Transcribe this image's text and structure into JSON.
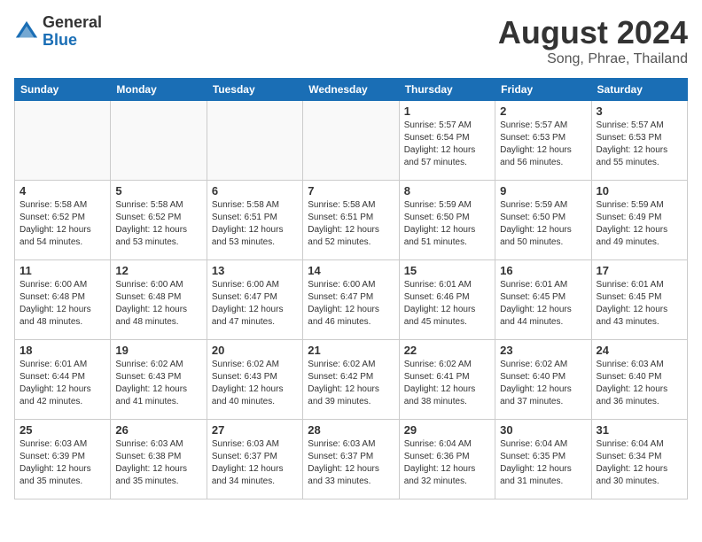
{
  "logo": {
    "general": "General",
    "blue": "Blue"
  },
  "title": "August 2024",
  "subtitle": "Song, Phrae, Thailand",
  "days_of_week": [
    "Sunday",
    "Monday",
    "Tuesday",
    "Wednesday",
    "Thursday",
    "Friday",
    "Saturday"
  ],
  "weeks": [
    [
      {
        "day": "",
        "info": ""
      },
      {
        "day": "",
        "info": ""
      },
      {
        "day": "",
        "info": ""
      },
      {
        "day": "",
        "info": ""
      },
      {
        "day": "1",
        "info": "Sunrise: 5:57 AM\nSunset: 6:54 PM\nDaylight: 12 hours and 57 minutes."
      },
      {
        "day": "2",
        "info": "Sunrise: 5:57 AM\nSunset: 6:53 PM\nDaylight: 12 hours and 56 minutes."
      },
      {
        "day": "3",
        "info": "Sunrise: 5:57 AM\nSunset: 6:53 PM\nDaylight: 12 hours and 55 minutes."
      }
    ],
    [
      {
        "day": "4",
        "info": "Sunrise: 5:58 AM\nSunset: 6:52 PM\nDaylight: 12 hours and 54 minutes."
      },
      {
        "day": "5",
        "info": "Sunrise: 5:58 AM\nSunset: 6:52 PM\nDaylight: 12 hours and 53 minutes."
      },
      {
        "day": "6",
        "info": "Sunrise: 5:58 AM\nSunset: 6:51 PM\nDaylight: 12 hours and 53 minutes."
      },
      {
        "day": "7",
        "info": "Sunrise: 5:58 AM\nSunset: 6:51 PM\nDaylight: 12 hours and 52 minutes."
      },
      {
        "day": "8",
        "info": "Sunrise: 5:59 AM\nSunset: 6:50 PM\nDaylight: 12 hours and 51 minutes."
      },
      {
        "day": "9",
        "info": "Sunrise: 5:59 AM\nSunset: 6:50 PM\nDaylight: 12 hours and 50 minutes."
      },
      {
        "day": "10",
        "info": "Sunrise: 5:59 AM\nSunset: 6:49 PM\nDaylight: 12 hours and 49 minutes."
      }
    ],
    [
      {
        "day": "11",
        "info": "Sunrise: 6:00 AM\nSunset: 6:48 PM\nDaylight: 12 hours and 48 minutes."
      },
      {
        "day": "12",
        "info": "Sunrise: 6:00 AM\nSunset: 6:48 PM\nDaylight: 12 hours and 48 minutes."
      },
      {
        "day": "13",
        "info": "Sunrise: 6:00 AM\nSunset: 6:47 PM\nDaylight: 12 hours and 47 minutes."
      },
      {
        "day": "14",
        "info": "Sunrise: 6:00 AM\nSunset: 6:47 PM\nDaylight: 12 hours and 46 minutes."
      },
      {
        "day": "15",
        "info": "Sunrise: 6:01 AM\nSunset: 6:46 PM\nDaylight: 12 hours and 45 minutes."
      },
      {
        "day": "16",
        "info": "Sunrise: 6:01 AM\nSunset: 6:45 PM\nDaylight: 12 hours and 44 minutes."
      },
      {
        "day": "17",
        "info": "Sunrise: 6:01 AM\nSunset: 6:45 PM\nDaylight: 12 hours and 43 minutes."
      }
    ],
    [
      {
        "day": "18",
        "info": "Sunrise: 6:01 AM\nSunset: 6:44 PM\nDaylight: 12 hours and 42 minutes."
      },
      {
        "day": "19",
        "info": "Sunrise: 6:02 AM\nSunset: 6:43 PM\nDaylight: 12 hours and 41 minutes."
      },
      {
        "day": "20",
        "info": "Sunrise: 6:02 AM\nSunset: 6:43 PM\nDaylight: 12 hours and 40 minutes."
      },
      {
        "day": "21",
        "info": "Sunrise: 6:02 AM\nSunset: 6:42 PM\nDaylight: 12 hours and 39 minutes."
      },
      {
        "day": "22",
        "info": "Sunrise: 6:02 AM\nSunset: 6:41 PM\nDaylight: 12 hours and 38 minutes."
      },
      {
        "day": "23",
        "info": "Sunrise: 6:02 AM\nSunset: 6:40 PM\nDaylight: 12 hours and 37 minutes."
      },
      {
        "day": "24",
        "info": "Sunrise: 6:03 AM\nSunset: 6:40 PM\nDaylight: 12 hours and 36 minutes."
      }
    ],
    [
      {
        "day": "25",
        "info": "Sunrise: 6:03 AM\nSunset: 6:39 PM\nDaylight: 12 hours and 35 minutes."
      },
      {
        "day": "26",
        "info": "Sunrise: 6:03 AM\nSunset: 6:38 PM\nDaylight: 12 hours and 35 minutes."
      },
      {
        "day": "27",
        "info": "Sunrise: 6:03 AM\nSunset: 6:37 PM\nDaylight: 12 hours and 34 minutes."
      },
      {
        "day": "28",
        "info": "Sunrise: 6:03 AM\nSunset: 6:37 PM\nDaylight: 12 hours and 33 minutes."
      },
      {
        "day": "29",
        "info": "Sunrise: 6:04 AM\nSunset: 6:36 PM\nDaylight: 12 hours and 32 minutes."
      },
      {
        "day": "30",
        "info": "Sunrise: 6:04 AM\nSunset: 6:35 PM\nDaylight: 12 hours and 31 minutes."
      },
      {
        "day": "31",
        "info": "Sunrise: 6:04 AM\nSunset: 6:34 PM\nDaylight: 12 hours and 30 minutes."
      }
    ]
  ]
}
